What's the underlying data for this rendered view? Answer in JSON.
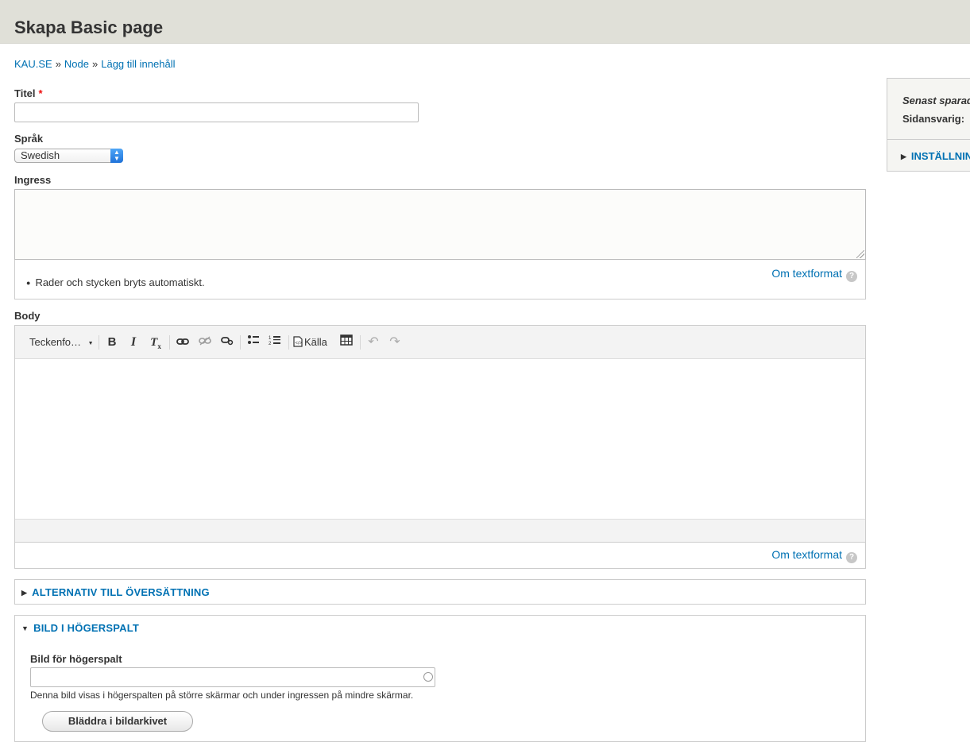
{
  "page": {
    "title": "Skapa Basic page"
  },
  "breadcrumb": {
    "items": [
      "KAU.SE",
      "Node",
      "Lägg till innehåll"
    ],
    "separator": "»"
  },
  "form": {
    "title_label": "Titel",
    "required_marker": "*",
    "title_value": "",
    "language_label": "Språk",
    "language_value": "Swedish",
    "ingress_label": "Ingress",
    "ingress_value": "",
    "ingress_format_tip": "Rader och stycken bryts automatiskt.",
    "format_link": "Om textformat",
    "body_label": "Body",
    "body_value": ""
  },
  "toolbar": {
    "font_format": "Teckenfo…",
    "source_label": "Källa",
    "icons": [
      "bold-icon",
      "italic-icon",
      "remove-format-icon",
      "link-icon",
      "unlink-icon",
      "anchor-icon",
      "bulleted-list-icon",
      "numbered-list-icon",
      "source-icon",
      "table-icon",
      "undo-icon",
      "redo-icon"
    ]
  },
  "sections": {
    "translation_title": "ALTERNATIV TILL ÖVERSÄTTNING",
    "image_title": "BILD I HÖGERSPALT",
    "image_field_label": "Bild för högerspalt",
    "image_field_value": "",
    "image_description": "Denna bild visas i högerspalten på större skärmar och under ingressen på mindre skärmar.",
    "browse_button": "Bläddra i bildarkivet"
  },
  "sidebar": {
    "last_saved": "Senast sparad:",
    "owner": "Sidansvarig:",
    "settings": "INSTÄLLNINGAR"
  },
  "colors": {
    "link": "#0071b3",
    "header_bg": "#e0e0d8",
    "required": "#ee1111"
  }
}
